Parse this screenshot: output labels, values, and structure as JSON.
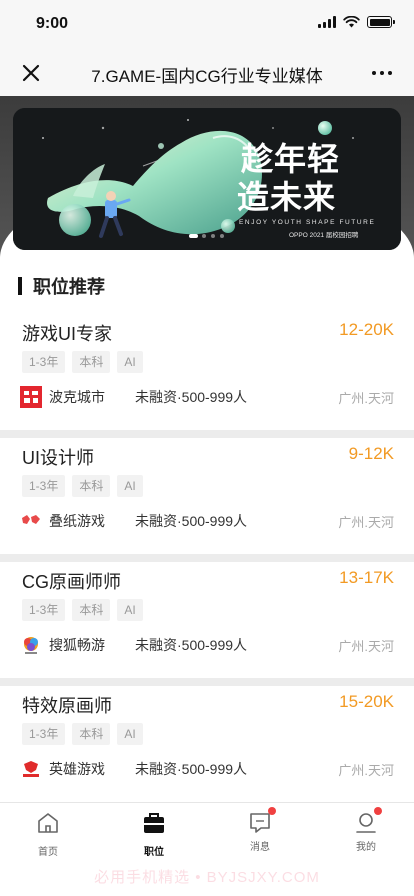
{
  "status": {
    "time": "9:00"
  },
  "nav": {
    "title": "7.GAME-国内CG行业专业媒体"
  },
  "banner": {
    "headline_1": "趁年轻",
    "headline_2": "造未来",
    "tagline": "ENJOY YOUTH SHAPE FUTURE",
    "caption": "OPPO 2021 届校园招聘"
  },
  "section": {
    "title": "职位推荐"
  },
  "jobs": [
    {
      "title": "游戏UI专家",
      "salary": "12-20K",
      "tags": [
        "1-3年",
        "本科",
        "AI"
      ],
      "company": "波克城市",
      "info": "未融资·500-999人",
      "location": "广州.天河"
    },
    {
      "title": "UI设计师",
      "salary": "9-12K",
      "tags": [
        "1-3年",
        "本科",
        "AI"
      ],
      "company": "叠纸游戏",
      "info": "未融资·500-999人",
      "location": "广州.天河"
    },
    {
      "title": "CG原画师师",
      "salary": "13-17K",
      "tags": [
        "1-3年",
        "本科",
        "AI"
      ],
      "company": "搜狐畅游",
      "info": "未融资·500-999人",
      "location": "广州.天河"
    },
    {
      "title": "特效原画师",
      "salary": "15-20K",
      "tags": [
        "1-3年",
        "本科",
        "AI"
      ],
      "company": "英雄游戏",
      "info": "未融资·500-999人",
      "location": "广州.天河"
    }
  ],
  "tabs": [
    {
      "label": "首页",
      "icon": "home-icon"
    },
    {
      "label": "职位",
      "icon": "briefcase-icon"
    },
    {
      "label": "消息",
      "icon": "message-icon"
    },
    {
      "label": "我的",
      "icon": "profile-icon"
    }
  ],
  "watermark": "必用手机精选 • BYJSJXY.COM"
}
